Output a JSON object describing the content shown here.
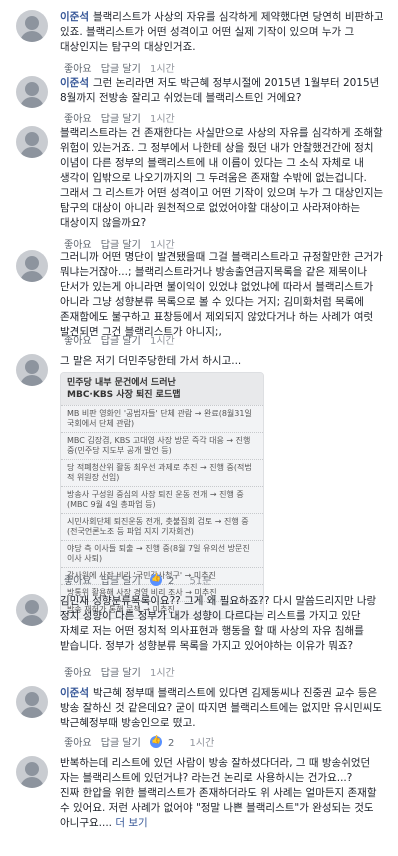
{
  "labels": {
    "like": "좋아요",
    "reply": "답글 달기"
  },
  "comments": [
    {
      "author": "이준석",
      "text": "블랙리스트가 사상의 자유를 심각하게 제약했다면 당연히 비판하고 있죠. 블랙리스트가 어떤 성격이고 어떤 실제 기작이 있으며 누가 그 대상인지는 탐구의 대상인거죠.",
      "time": "1시간",
      "reactions": ""
    },
    {
      "author": "이준석",
      "mention": "",
      "text": "그런 논리라면 저도 박근혜 정부시절에 2015년 1월부터 2015년 8월까지 전방송 잘리고 쉬었는데 블랙리스트인 거에요?",
      "time": "1시간",
      "reactions": ""
    },
    {
      "author": "",
      "text": "블랙리스트라는 건 존재한다는 사실만으로 사상의 자유를 심각하게 조해할 위험이 있는거죠. 그 정부에서 나한테 상을 줬던 내가 안찰했건간에 정치 이념이 다른 정부의 블랙리스트에 내 이름이 있다는 그 소식 자체로 내 생각이 입밖으로 나오기까지의 그 두려움은 존재할 수밖에 없는겁니다. 그래서 그 리스트가 어떤 성격이고 어떤 기작이 있으며 누가 그 대상인지는 탐구의 대상이 아니라 원천적으로 없었어야할 대상이고 사라져야하는 대상이지 않을까요?",
      "time": "1시간",
      "reactions": ""
    },
    {
      "author": "",
      "text": "그러니까 어떤 명단이 발견됐을때 그걸 블랙리스트라고 규정할만한 근거가 뭐냐는거잖아...; 블랙리스트라거나 방송출연금지목록을 같은 제목이나 단서가 있는게 아니라면 불이익이 있었냐 없었냐에 따라서 블랙리스트가 아니라 그냥 성향분류 목록으로 볼 수 있다는 거지; 김미화처럼 목록에 존재함에도 불구하고 표창등에서 제외되지 않았다거나 하는 사례가 여럿 발견되면 그건 블랙리스트가 아니지;,",
      "time": "1시간",
      "reactions": ""
    },
    {
      "author": "",
      "text": "그 말은 저기 더민주당한테 가서 하시고...",
      "time": "51분",
      "reactions": "2"
    },
    {
      "author": "",
      "text": "김민재 성향분류목록이요?? 그게 왜 필요하죠?? 다시 말씀드리지만 나랑 정치 성향이 다른 정부가 내가 성향이 다르다는 리스트를 가지고 있단 자체로 저는 어떤 정치적 의사표현과 행동을 할 때 사상의 자유 침해를 받습니다. 정부가 성향분류 목록을 가지고 있어야하는 이유가 뭐죠?",
      "time": "1시간",
      "reactions": ""
    },
    {
      "author": "이준석",
      "text": "박근혜 정부때 블랙리스트에 있다면 김제동씨나 진중권 교수 등은 방송 잘하신 것 같은데요? 굳이 따지면 블랙리스트에는 없지만 유시민씨도 박근혜정부때 방송인으로 떴고.",
      "time": "1시간",
      "reactions": "2"
    },
    {
      "author": "",
      "text": "반복하는데 리스트에 있던 사람이 방송 잘하셨다더라, 그 때 방송쉬었던 자는 블랙리스트에 있던거냐? 라는건 논리로 사용하시는 건가요...?\n진짜 한압을 위한 블랙리스트가 존재하더라도 위 사례는 얼마든지 존재할 수 있어요. 저런 사례가 없어야 \"정말 나쁜 블랙리스트\"가 완성되는 것도 아니구요.... ",
      "see_more": "더 보기",
      "time": "",
      "reactions": ""
    }
  ],
  "image_card": {
    "title_line1": "민주당 내부 문건에서 드러난",
    "title_line2": "MBC·KBS 사장 퇴진 로드맵",
    "rows": [
      "MB 비판 영화인 '공범자들' 단체 관람 → 완료(8월31일 국회에서 단체 관람)",
      "MBC 김장겸, KBS 고대영 사장 방문 즉각 대응 → 진행 중(민주당 지도부 공개 발언 등)",
      "당 적폐청산위 활동 최우선 과제로 추진 → 진행 중(적법적 위원장 선임)",
      "방송사 구성원 중심의 사장 퇴진 운동 전개 → 진행 중(MBC 9월 4일 총파업 등)",
      "시민사회단체 퇴진운동 전개, 촛불집회 검토 → 진행 중(전국언론노조 등 파업 지지 기자회견)",
      "야당 측 이사들 퇴출 → 진행 중(8월 7일 유의선 방문진 이사 사퇴)",
      "감사원에 사장 비리 '국민감사청구' → 미추진",
      "방통위 활용해 사장 경영 비리 조사 → 미추진",
      "방송 재허가 통해 문책 → 미추진"
    ]
  }
}
